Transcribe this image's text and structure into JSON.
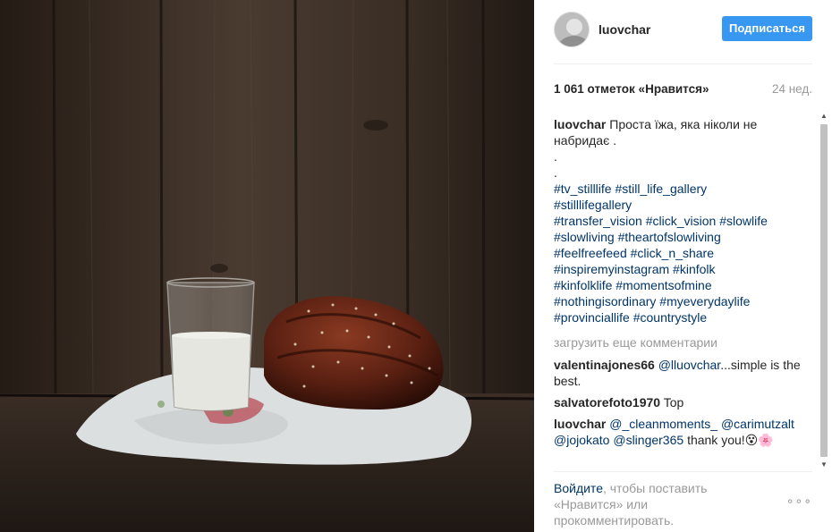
{
  "post": {
    "username": "luovchar",
    "follow_label": "Подписаться",
    "likes": "1 061 отметок «Нравится»",
    "time_ago": "24 нед."
  },
  "caption": {
    "user": "luovchar",
    "text": "Проста їжа, яка ніколи не набридає .",
    "dot1": ".",
    "dot2": ".",
    "hashtags": [
      "#tv_stilllife #still_life_gallery",
      "#stilllifegallery",
      "#transfer_vision #click_vision #slowlife",
      "#slowliving #theartofslowliving",
      "#feelfreefeed #click_n_share",
      "#inspiremyinstagram #kinfolk",
      "#kinfolklife #momentsofmine",
      "#nothingisordinary #myeverydaylife",
      "#provinciallife #countrystyle"
    ]
  },
  "load_more": "загрузить еще комментарии",
  "comments": [
    {
      "user": "valentinajones66",
      "mention": "@lluovchar",
      "text": "...simple is the best."
    },
    {
      "user": "salvatorefoto1970",
      "mention": "",
      "text": "Top"
    },
    {
      "user": "luovchar",
      "mention": "@_cleanmoments_ @carimutzalt @jojokato @slinger365",
      "text": "thank you!😵🌸"
    }
  ],
  "footer": {
    "login_link": "Войдите",
    "login_text": ", чтобы поставить «Нравится» или прокомментировать.",
    "more_icon": "ellipsis-icon",
    "more_glyph": "∘∘∘"
  },
  "colors": {
    "accent": "#3897f0",
    "link": "#003569",
    "muted": "#999999"
  }
}
